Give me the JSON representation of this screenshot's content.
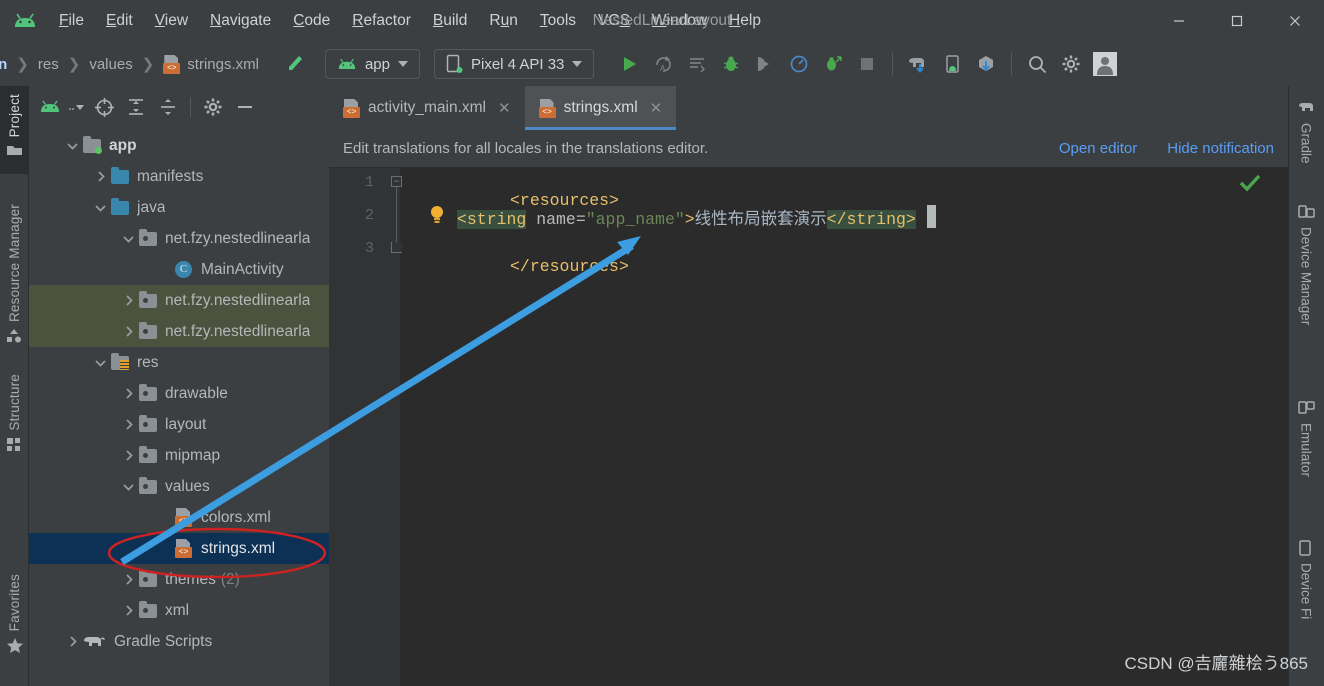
{
  "window": {
    "title": "NestedLinearLayout",
    "minimize": "–",
    "maximize": "□",
    "close": "✕"
  },
  "menubar": {
    "logo_icon": "android-logo-icon",
    "items": [
      {
        "label": "File",
        "mnemonic": "F"
      },
      {
        "label": "Edit",
        "mnemonic": "E"
      },
      {
        "label": "View",
        "mnemonic": "V"
      },
      {
        "label": "Navigate",
        "mnemonic": "N"
      },
      {
        "label": "Code",
        "mnemonic": "C"
      },
      {
        "label": "Refactor",
        "mnemonic": "R"
      },
      {
        "label": "Build",
        "mnemonic": "B"
      },
      {
        "label": "Run",
        "mnemonic": "u"
      },
      {
        "label": "Tools",
        "mnemonic": "T"
      },
      {
        "label": "VCS",
        "mnemonic": "S"
      },
      {
        "label": "Window",
        "mnemonic": "W"
      },
      {
        "label": "Help",
        "mnemonic": "H"
      }
    ]
  },
  "toolbar": {
    "breadcrumb": [
      "in",
      "res",
      "values",
      "strings.xml"
    ],
    "breadcrumb_separator": "❯",
    "file_icon": "xml-file-icon",
    "make_project_icon": "make-project-hammer-icon",
    "run_config": {
      "label": "app",
      "icon": "android-module-icon"
    },
    "device_config": {
      "label": "Pixel 4 API 33",
      "icon": "device-phone-icon"
    },
    "actions": [
      {
        "name": "run-button",
        "icon": "play-triangle-icon"
      },
      {
        "name": "apply-changes-button",
        "icon": "apply-changes-icon"
      },
      {
        "name": "apply-code-changes-button",
        "icon": "apply-code-changes-icon"
      },
      {
        "name": "debug-button",
        "icon": "bug-icon"
      },
      {
        "name": "attach-debugger-button",
        "icon": "attach-debugger-icon"
      },
      {
        "name": "profiler-button",
        "icon": "profiler-gauge-icon"
      },
      {
        "name": "run-with-coverage-button",
        "icon": "coverage-icon"
      },
      {
        "name": "stop-button",
        "icon": "stop-square-icon"
      },
      {
        "name": "sync-gradle-button",
        "icon": "gradle-sync-elephant-icon"
      },
      {
        "name": "avd-manager-button",
        "icon": "avd-manager-icon"
      },
      {
        "name": "sdk-manager-button",
        "icon": "sdk-manager-box-icon"
      },
      {
        "name": "search-everywhere-button",
        "icon": "search-icon"
      },
      {
        "name": "settings-button",
        "icon": "gear-icon"
      },
      {
        "name": "account-button",
        "icon": "user-avatar-icon"
      }
    ]
  },
  "left_toolwindows": [
    {
      "label": "Project",
      "icon": "folder-icon",
      "active": true
    },
    {
      "label": "Resource Manager",
      "icon": "resource-manager-icon",
      "active": false
    },
    {
      "label": "Structure",
      "icon": "structure-icon",
      "active": false
    },
    {
      "label": "Favorites",
      "icon": "star-icon",
      "active": false
    }
  ],
  "right_toolwindows": [
    {
      "label": "Gradle",
      "icon": "gradle-elephant-icon"
    },
    {
      "label": "Device Manager",
      "icon": "device-manager-icon"
    },
    {
      "label": "Emulator",
      "icon": "emulator-icon"
    },
    {
      "label": "Device Fi",
      "icon": "device-file-explorer-icon"
    }
  ],
  "project_panel": {
    "toolbar_actions": [
      {
        "name": "project-view-selector",
        "icon": "android-view-icon"
      },
      {
        "name": "view-mode-dropdown",
        "icon": "chevron-down-icon"
      },
      {
        "name": "select-opened-file",
        "icon": "target-crosshair-icon"
      },
      {
        "name": "expand-all",
        "icon": "expand-all-icon"
      },
      {
        "name": "collapse-all",
        "icon": "collapse-all-icon"
      },
      {
        "name": "settings",
        "icon": "gear-icon"
      },
      {
        "name": "hide-panel",
        "icon": "minus-icon"
      }
    ],
    "tree": [
      {
        "label": "app",
        "indent": 0,
        "arrow": "down",
        "icon": "module-folder-icon",
        "state": "normal"
      },
      {
        "label": "manifests",
        "indent": 1,
        "arrow": "right",
        "icon": "folder-blue-icon",
        "state": "normal"
      },
      {
        "label": "java",
        "indent": 1,
        "arrow": "down",
        "icon": "folder-blue-icon",
        "state": "normal"
      },
      {
        "label": "net.fzy.nestedlinearla",
        "indent": 2,
        "arrow": "down",
        "icon": "package-icon",
        "state": "normal"
      },
      {
        "label": "MainActivity",
        "indent": 3,
        "arrow": "none",
        "icon": "class-icon",
        "state": "normal"
      },
      {
        "label": "net.fzy.nestedlinearla",
        "indent": 2,
        "arrow": "right",
        "icon": "package-icon",
        "state": "highlight"
      },
      {
        "label": "net.fzy.nestedlinearla",
        "indent": 2,
        "arrow": "right",
        "icon": "package-icon",
        "state": "highlight"
      },
      {
        "label": "res",
        "indent": 1,
        "arrow": "down",
        "icon": "res-folder-icon",
        "state": "normal"
      },
      {
        "label": "drawable",
        "indent": 2,
        "arrow": "right",
        "icon": "package-icon",
        "state": "normal"
      },
      {
        "label": "layout",
        "indent": 2,
        "arrow": "right",
        "icon": "package-icon",
        "state": "normal"
      },
      {
        "label": "mipmap",
        "indent": 2,
        "arrow": "right",
        "icon": "package-icon",
        "state": "normal"
      },
      {
        "label": "values",
        "indent": 2,
        "arrow": "down",
        "icon": "package-icon",
        "state": "normal"
      },
      {
        "label": "colors.xml",
        "indent": 3,
        "arrow": "none",
        "icon": "xml-file-icon",
        "state": "normal"
      },
      {
        "label": "strings.xml",
        "indent": 3,
        "arrow": "none",
        "icon": "xml-file-icon",
        "state": "selected"
      },
      {
        "label": "themes",
        "indent": 2,
        "arrow": "right",
        "icon": "package-icon",
        "state": "normal",
        "suffix": "(2)"
      },
      {
        "label": "xml",
        "indent": 2,
        "arrow": "right",
        "icon": "package-icon",
        "state": "normal"
      },
      {
        "label": "Gradle Scripts",
        "indent": 0,
        "arrow": "right",
        "icon": "gradle-elephant-icon",
        "state": "normal"
      }
    ]
  },
  "editor": {
    "tabs": [
      {
        "label": "activity_main.xml",
        "icon": "xml-file-icon",
        "active": false,
        "close": "✕"
      },
      {
        "label": "strings.xml",
        "icon": "xml-file-icon",
        "active": true,
        "close": "✕"
      }
    ],
    "notification": {
      "message": "Edit translations for all locales in the translations editor.",
      "open_editor_label": "Open editor",
      "hide_notification_label": "Hide notification"
    },
    "line_numbers": [
      "1",
      "2",
      "3"
    ],
    "fold_markers": [
      "−",
      "⌐"
    ],
    "inspection_status_icon": "green-check-icon",
    "gutter_hint_icon": "intention-bulb-icon",
    "code": {
      "line1": "<resources>",
      "line2_tag_open": "<string",
      "line2_attr": " name=",
      "line2_value": "\"app_name\"",
      "line2_gt": ">",
      "line2_text": "线性布局嵌套演示",
      "line2_tag_close": "</string>",
      "line3": "</resources>"
    }
  },
  "annotations": {
    "ellipse_color": "#cc2222",
    "arrow_color": "#3c9ee0",
    "ellipse_target": "strings.xml",
    "arrow_from": "strings.xml tree item",
    "arrow_to": "app_name attribute value"
  },
  "watermark": {
    "text": "CSDN @𠮷廲雜桧う865"
  },
  "colors": {
    "background": "#3c3f41",
    "editor_background": "#2b2b2b",
    "selection": "#0d3055",
    "highlight": "#4b533f",
    "accent_blue": "#4a88c7",
    "link_blue": "#589df6",
    "tag_yellow": "#e8bf6a",
    "string_green": "#6a8759",
    "android_green": "#52c47c"
  }
}
